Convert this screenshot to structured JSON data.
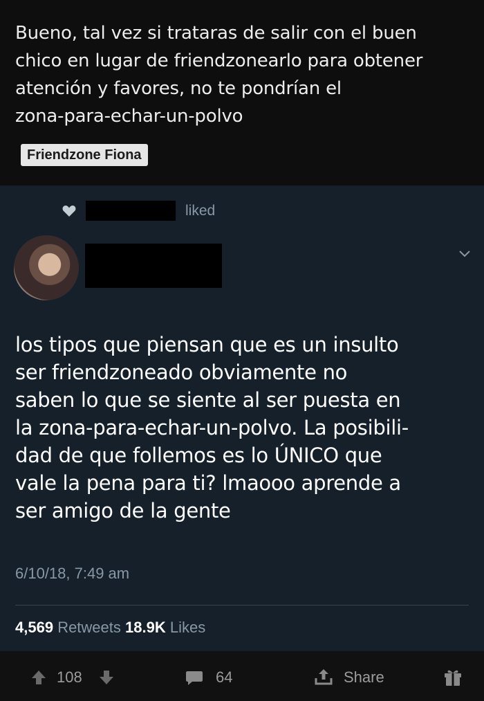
{
  "caption": {
    "lines": [
      "Bueno, tal vez si trataras de salir con el buen",
      "chico en lugar de friendzonearlo para obtener",
      "atención y favores, no te pondrían el",
      "zona-para-echar-un-polvo"
    ],
    "tag": "Friendzone Fiona"
  },
  "tweet": {
    "liked_label": "liked",
    "text_lines": [
      "los tipos que piensan que es un insulto",
      "ser friendzoneado obviamente no",
      "saben lo que se siente al ser puesta en",
      "la zona-para-echar-un-polvo. La posibili-",
      "dad de que follemos es lo ÚNICO que",
      "vale la pena para ti? lmaooo aprende a",
      "ser amigo de la gente"
    ],
    "timestamp": "6/10/18, 7:49 am",
    "retweets_count": "4,569",
    "retweets_label": "Retweets",
    "likes_count": "18.9K",
    "likes_label": "Likes"
  },
  "actions": {
    "upvotes": "108",
    "comments": "64",
    "share_label": "Share"
  },
  "colors": {
    "tweet_bg": "#15202b",
    "caption_bg": "#0e0e0f",
    "muted_text": "#8899a6",
    "tag_bg": "#e6e6e6"
  },
  "icons": [
    "heart-icon",
    "chevron-down-icon",
    "upvote-icon",
    "downvote-icon",
    "comment-icon",
    "share-icon",
    "gift-icon"
  ]
}
